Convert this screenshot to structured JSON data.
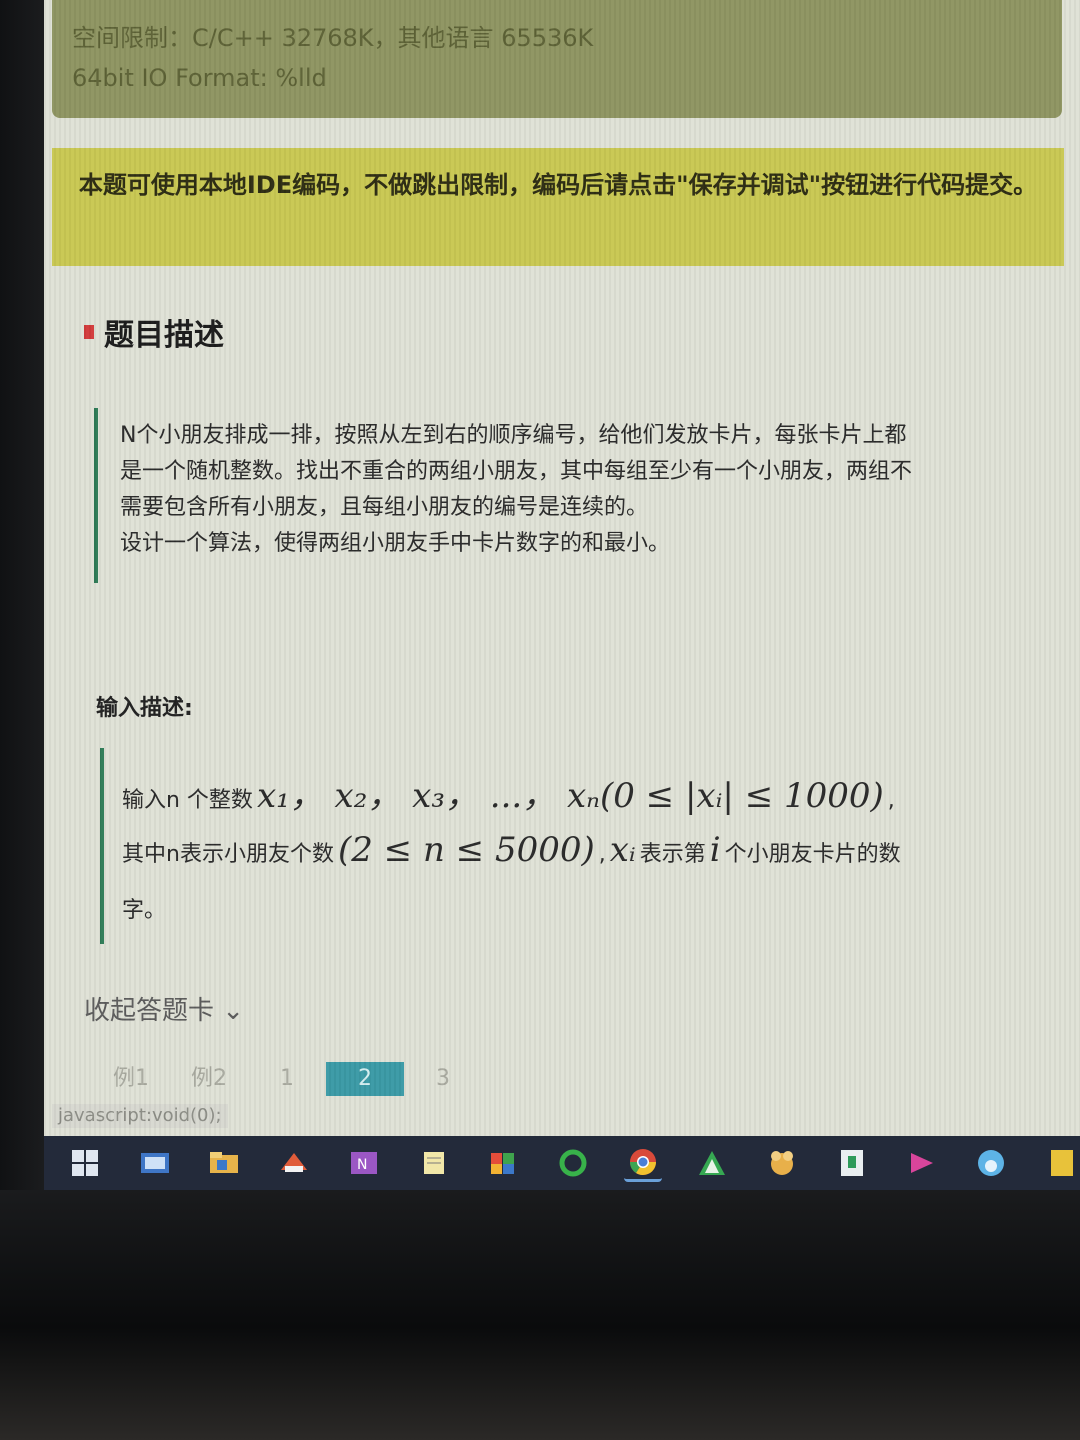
{
  "info": {
    "memory_limit": "空间限制：C/C++ 32768K，其他语言 65536K",
    "io_format": "64bit IO Format: %lld"
  },
  "notice": {
    "text": "本题可使用本地IDE编码，不做跳出限制，编码后请点击\"保存并调试\"按钮进行代码提交。"
  },
  "problem": {
    "title": "题目描述",
    "description": [
      "N个小朋友排成一排，按照从左到右的顺序编号，给他们发放卡片，每张卡片上都",
      "是一个随机整数。找出不重合的两组小朋友，其中每组至少有一个小朋友，两组不",
      "需要包含所有小朋友，且每组小朋友的编号是连续的。",
      "设计一个算法，使得两组小朋友手中卡片数字的和最小。"
    ]
  },
  "input": {
    "label": "输入描述:",
    "line1_prefix": "输入n 个整数",
    "line1_math": "x₁， x₂， x₃， ...， xₙ(0 ≤ |xᵢ| ≤ 1000)",
    "line1_suffix": ",",
    "line2_prefix": "其中n表示小朋友个数",
    "line2_math1": "(2 ≤ n ≤ 5000)",
    "line2_mid": ",",
    "line2_math2": "xᵢ",
    "line2_mid2": "表示第",
    "line2_math3": "i",
    "line2_suffix": "个小朋友卡片的数",
    "line3": "字。"
  },
  "answer_card": {
    "collapse_label": "收起答题卡 ⌄",
    "tabs": [
      "例1",
      "例2",
      "1",
      "2",
      "3"
    ],
    "active_tab": "2"
  },
  "status_bar": {
    "url": "javascript:void(0);"
  },
  "taskbar": {
    "icons": [
      "windows-start-icon",
      "explorer-icon",
      "file-manager-icon",
      "mail-icon",
      "onenote-icon",
      "notepad-icon",
      "paint-icon",
      "360-browser-icon",
      "chrome-icon",
      "app-icon",
      "app2-icon",
      "app3-icon",
      "app4-icon",
      "edge-icon",
      "app5-icon"
    ]
  }
}
